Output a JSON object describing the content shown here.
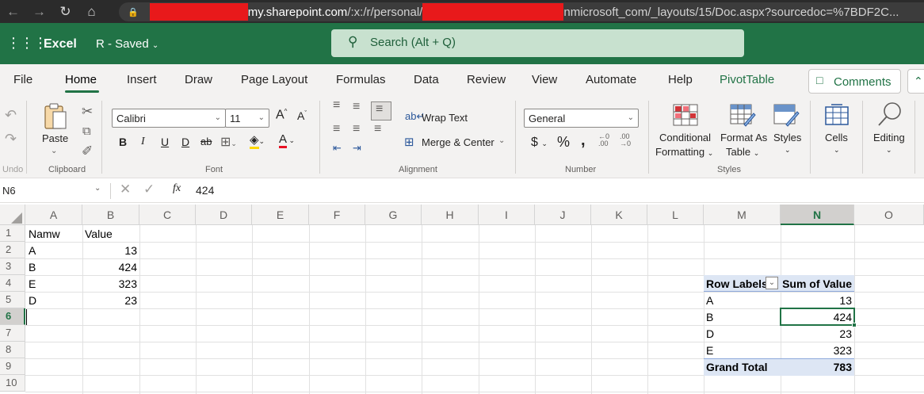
{
  "browser": {
    "url_host": "my.sharepoint.com",
    "url_path1": "/:x:/r/personal/",
    "url_path2": "nmicrosoft_com/_layouts/15/Doc.aspx?sourcedoc=%7BDF2C..."
  },
  "header": {
    "app_name": "Excel",
    "doc_name": "R - Saved",
    "search_placeholder": "Search (Alt + Q)"
  },
  "tabs": [
    "File",
    "Home",
    "Insert",
    "Draw",
    "Page Layout",
    "Formulas",
    "Data",
    "Review",
    "View",
    "Automate",
    "Help",
    "PivotTable"
  ],
  "comments_label": "Comments",
  "ribbon": {
    "undo_label": "Undo",
    "paste_label": "Paste",
    "clipboard_label": "Clipboard",
    "font_name": "Calibri",
    "font_size": "11",
    "font_label": "Font",
    "wrap_text": "Wrap Text",
    "merge_center": "Merge & Center",
    "alignment_label": "Alignment",
    "number_format": "General",
    "number_label": "Number",
    "conditional_formatting_1": "Conditional",
    "conditional_formatting_2": "Formatting",
    "format_as_table_1": "Format As",
    "format_as_table_2": "Table",
    "styles_btn": "Styles",
    "styles_label": "Styles",
    "cells_label": "Cells",
    "editing_label": "Editing"
  },
  "formula_bar": {
    "name_box": "N6",
    "fx": "fx",
    "value": "424"
  },
  "columns": [
    "A",
    "B",
    "C",
    "D",
    "E",
    "F",
    "G",
    "H",
    "I",
    "J",
    "K",
    "L",
    "M",
    "N",
    "O"
  ],
  "rows": [
    "1",
    "2",
    "3",
    "4",
    "5",
    "6",
    "7",
    "8",
    "9",
    "10"
  ],
  "source_data": {
    "header_name": "Namw",
    "header_value": "Value",
    "rows": [
      {
        "name": "A",
        "value": "13"
      },
      {
        "name": "B",
        "value": "424"
      },
      {
        "name": "E",
        "value": "323"
      },
      {
        "name": "D",
        "value": "23"
      }
    ]
  },
  "pivot": {
    "row_labels": "Row Labels",
    "sum_of_value": "Sum of Value",
    "rows": [
      {
        "label": "A",
        "value": "13"
      },
      {
        "label": "B",
        "value": "424"
      },
      {
        "label": "D",
        "value": "23"
      },
      {
        "label": "E",
        "value": "323"
      }
    ],
    "grand_total_label": "Grand Total",
    "grand_total_value": "783"
  },
  "colors": {
    "excel_green": "#217346",
    "pivot_header_fill": "#dde6f4",
    "redaction": "#e8191b"
  }
}
